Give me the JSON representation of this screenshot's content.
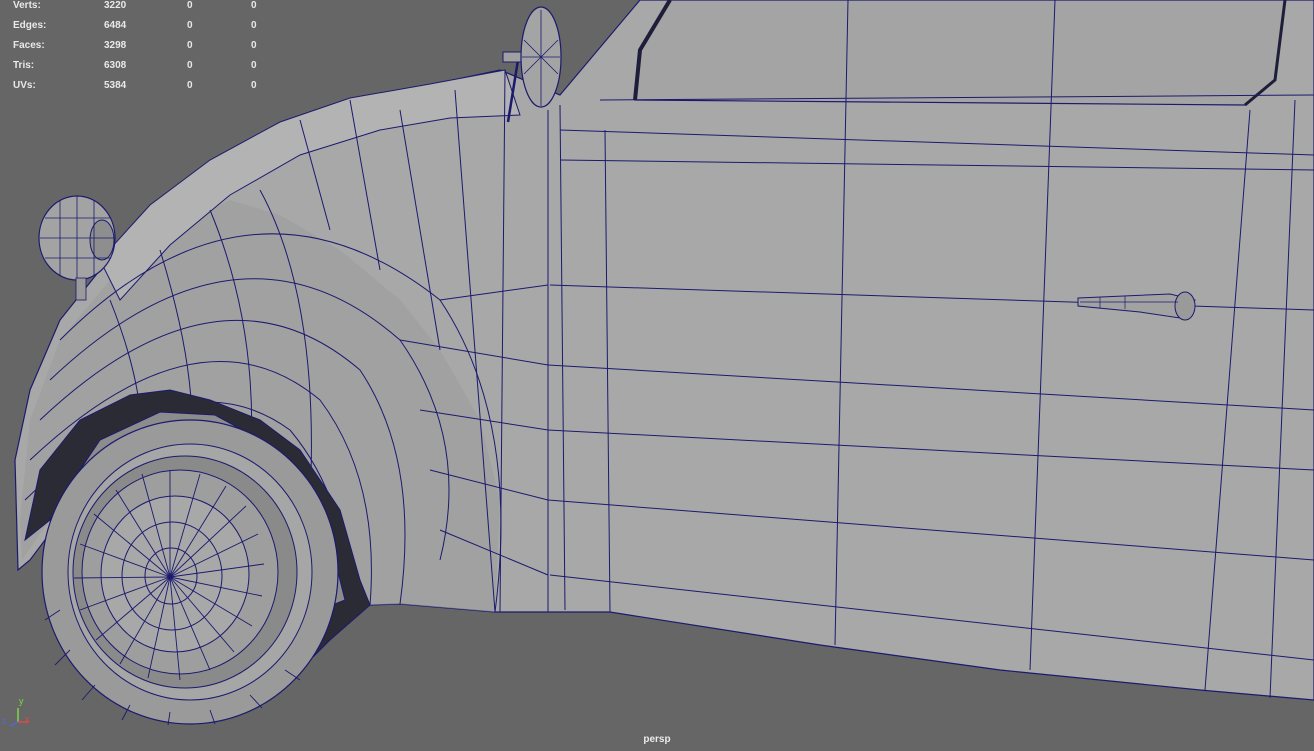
{
  "heads_up": {
    "rows": [
      {
        "label": "Verts:",
        "v1": "3220",
        "v2": "0",
        "v3": "0"
      },
      {
        "label": "Edges:",
        "v1": "6484",
        "v2": "0",
        "v3": "0"
      },
      {
        "label": "Faces:",
        "v1": "3298",
        "v2": "0",
        "v3": "0"
      },
      {
        "label": "Tris:",
        "v1": "6308",
        "v2": "0",
        "v3": "0"
      },
      {
        "label": "UVs:",
        "v1": "5384",
        "v2": "0",
        "v3": "0"
      }
    ]
  },
  "viewport": {
    "camera": "persp",
    "background_color": "#666666",
    "mesh_color": "#a9a9a9",
    "wire_color": "#1b1a6e"
  },
  "axis": {
    "y": "y",
    "x": "x",
    "z": "z",
    "y_color": "#7fd64a",
    "x_color": "#e04848",
    "z_color": "#4a6bd6"
  }
}
